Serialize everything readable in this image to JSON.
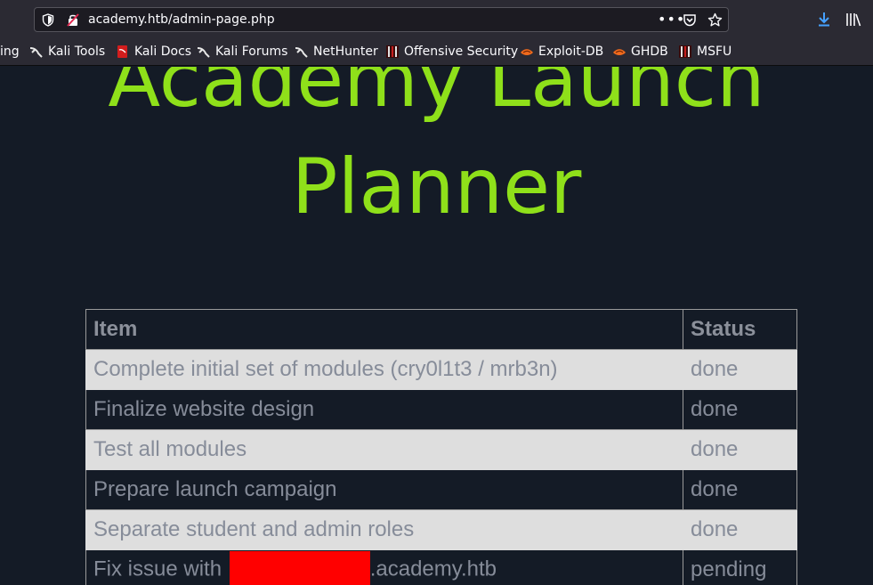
{
  "browser": {
    "url": "academy.htb/admin-page.php",
    "more_label": "•••"
  },
  "bookmarks": [
    {
      "label": "ing",
      "icon": "none"
    },
    {
      "label": "Kali Tools",
      "icon": "kali-dragon-icon"
    },
    {
      "label": "Kali Docs",
      "icon": "kali-docs-icon"
    },
    {
      "label": "Kali Forums",
      "icon": "kali-dragon-icon"
    },
    {
      "label": "NetHunter",
      "icon": "kali-dragon-icon"
    },
    {
      "label": "Offensive Security",
      "icon": "offsec-icon"
    },
    {
      "label": "Exploit-DB",
      "icon": "exploitdb-icon"
    },
    {
      "label": "GHDB",
      "icon": "exploitdb-icon"
    },
    {
      "label": "MSFU",
      "icon": "offsec-icon"
    }
  ],
  "page": {
    "title_line1": "Academy Launch",
    "title_line2": "Planner",
    "title_color": "#8fe01a",
    "table": {
      "headers": [
        "Item",
        "Status"
      ],
      "rows": [
        {
          "item": "Complete initial set of modules (cry0l1t3 / mrb3n)",
          "status": "done"
        },
        {
          "item": "Finalize website design",
          "status": "done"
        },
        {
          "item": "Test all modules",
          "status": "done"
        },
        {
          "item": "Prepare launch campaign",
          "status": "done"
        },
        {
          "item": "Separate student and admin roles",
          "status": "done"
        },
        {
          "item_prefix": "Fix issue with ",
          "item_suffix": ".academy.htb",
          "status": "pending"
        }
      ]
    }
  }
}
